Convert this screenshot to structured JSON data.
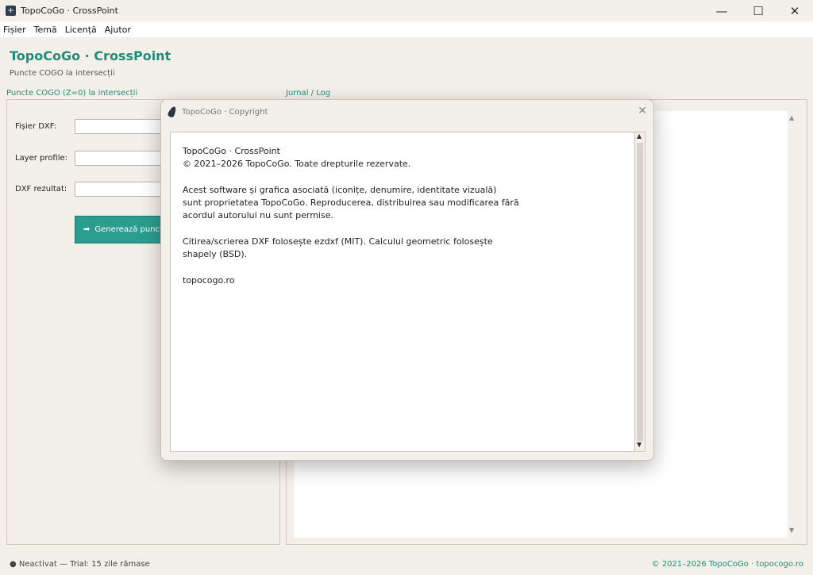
{
  "window": {
    "title": "TopoCoGo · CrossPoint",
    "app_icon_glyph": "+",
    "minimize_glyph": "—",
    "maximize_glyph": "☐",
    "close_glyph": "✕"
  },
  "menu": [
    "Fișier",
    "Temă",
    "Licență",
    "Ajutor"
  ],
  "header": {
    "title": "TopoCoGo · CrossPoint",
    "subtitle": "Puncte COGO la intersecții"
  },
  "left_panel": {
    "label": "Puncte COGO (Z=0) la intersecții",
    "fields": [
      {
        "label": "Fișier DXF:",
        "value": ""
      },
      {
        "label": "Layer profile:",
        "value": ""
      },
      {
        "label": "DXF rezultat:",
        "value": ""
      }
    ],
    "generate_icon": "➡",
    "generate_label": "Generează puncte"
  },
  "right_panel": {
    "label": "Jurnal / Log",
    "scroll_up": "▲",
    "scroll_down": "▼"
  },
  "dialog": {
    "title": "TopoCoGo · Copyright",
    "close_glyph": "✕",
    "scroll_up": "▲",
    "scroll_down": "▼",
    "text": "TopoCoGo · CrossPoint\n© 2021–2026 TopoCoGo. Toate drepturile rezervate.\n\nAcest software și grafica asociată (iconițe, denumire, identitate vizuală)\nsunt proprietatea TopoCoGo. Reproducerea, distribuirea sau modificarea fără\nacordul autorului nu sunt permise.\n\nCitirea/scrierea DXF folosește ezdxf (MIT). Calculul geometric folosește\nshapely (BSD).\n\ntopocogo.ro"
  },
  "status": {
    "left": "● Neactivat — Trial: 15 zile rămase",
    "right": "© 2021–2026 TopoCoGo · topocogo.ro"
  },
  "colors": {
    "accent": "#1f8c7a",
    "button": "#2a9d8f",
    "background": "#f3efe9"
  }
}
